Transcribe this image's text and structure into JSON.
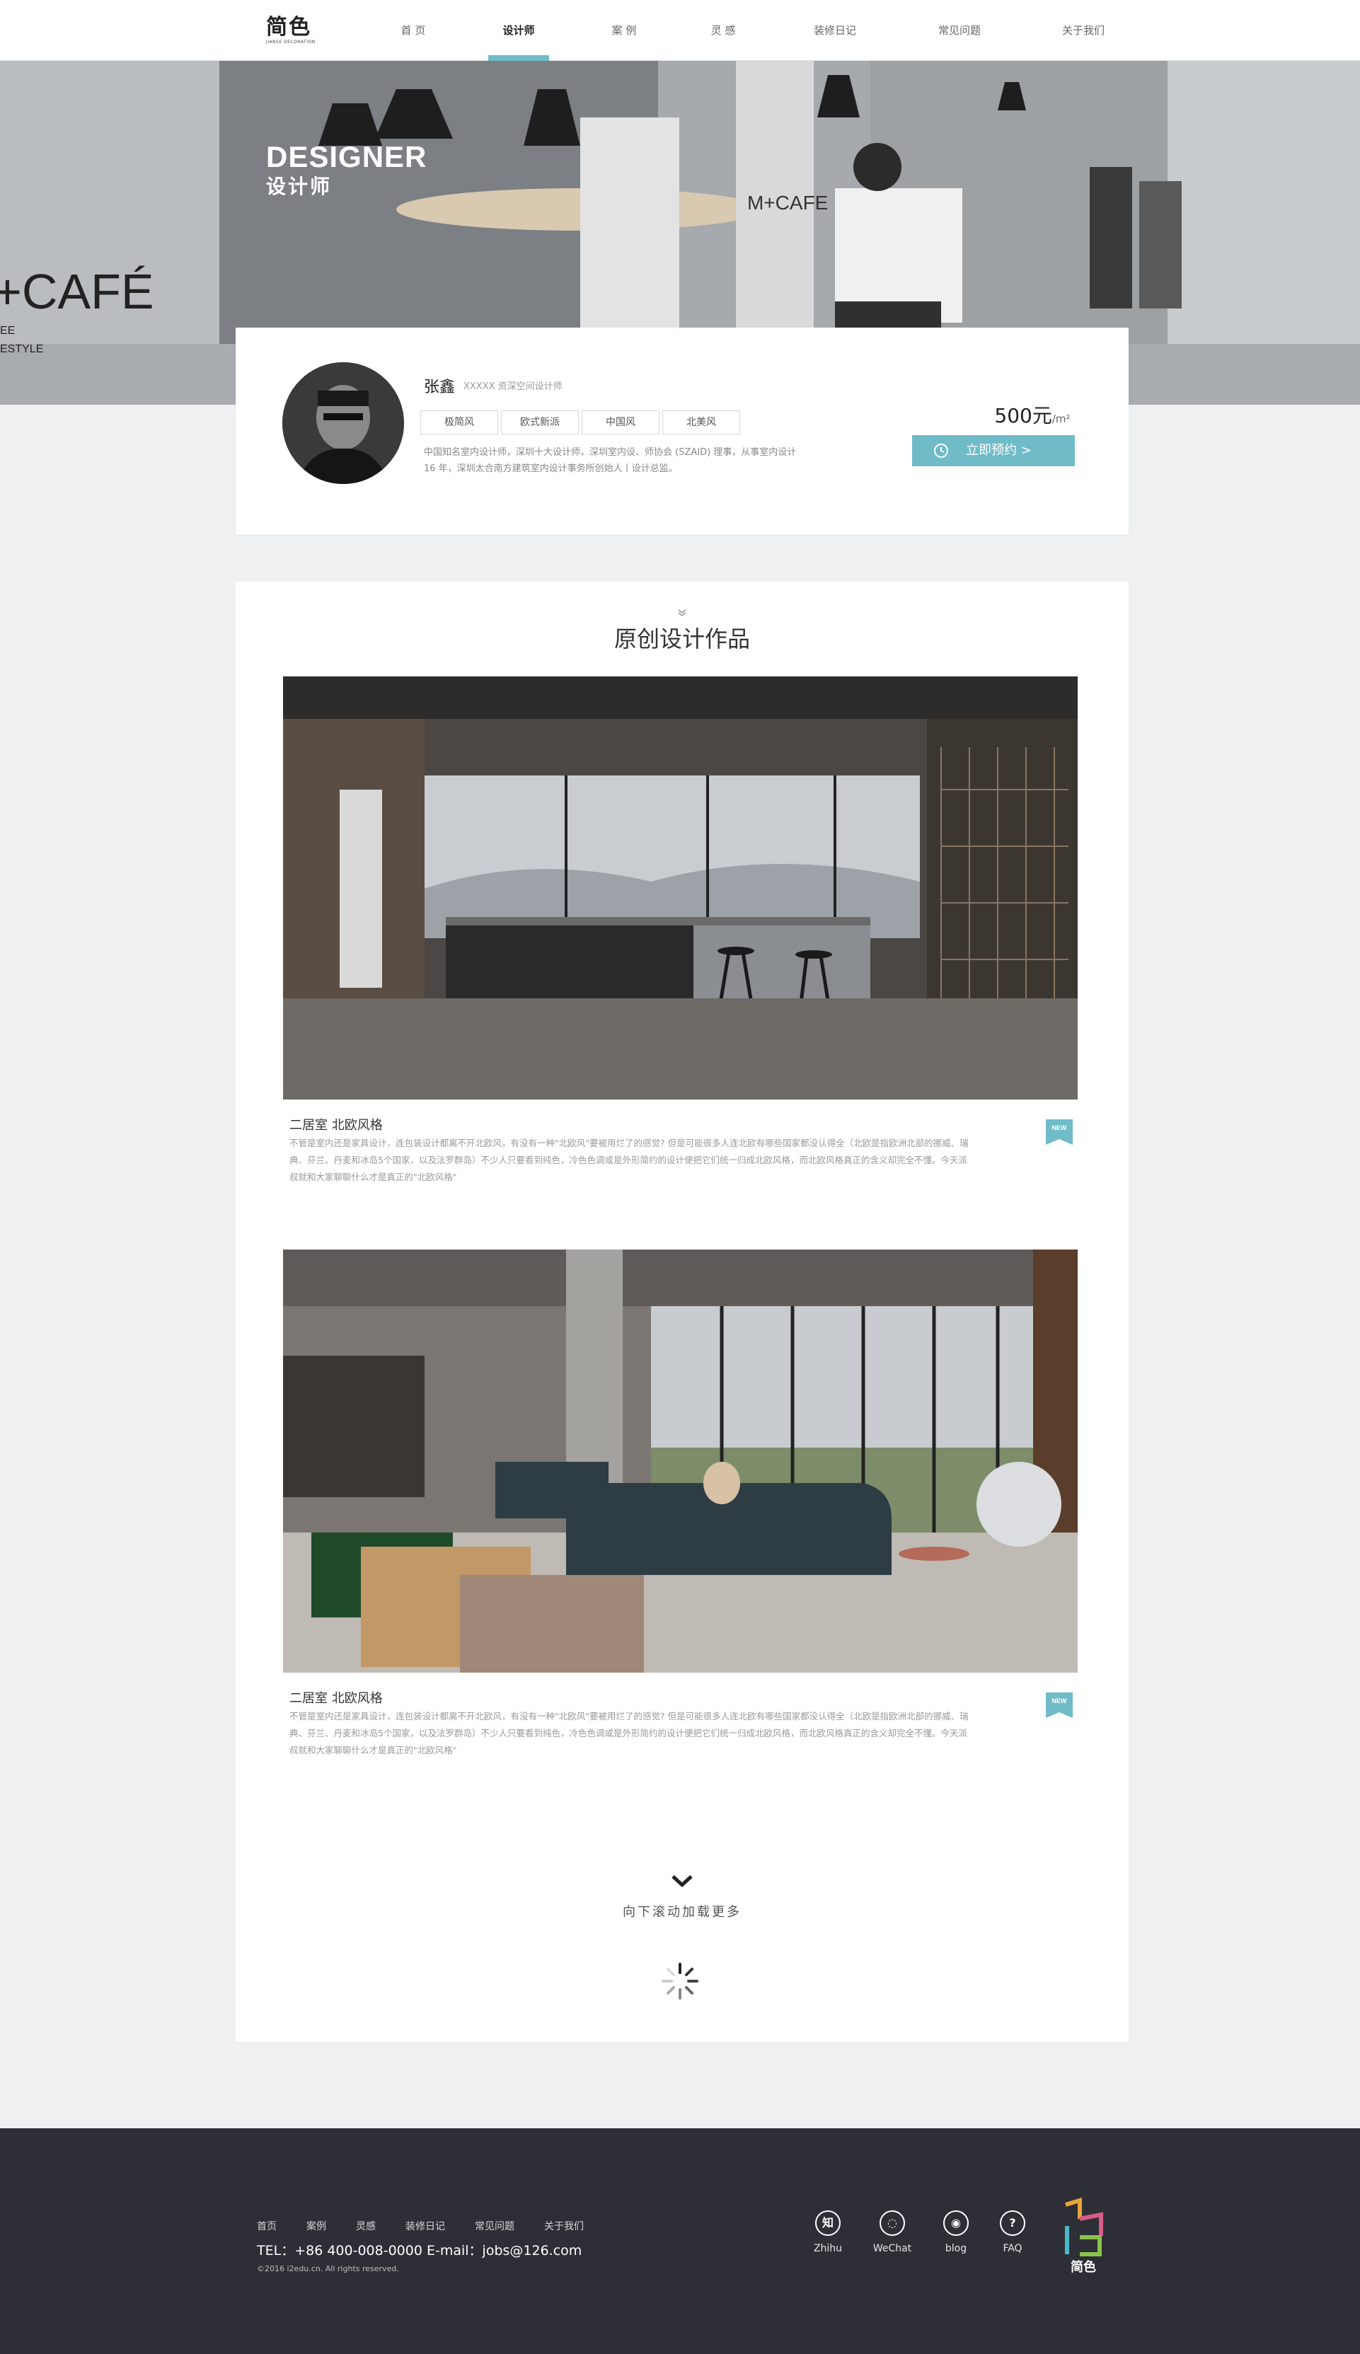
{
  "nav": {
    "logo": "简色",
    "logo_sub": "JIANSE DECORATION",
    "items": [
      "首 页",
      "设计师",
      "案 例",
      "灵 感",
      "装修日记",
      "常见问题",
      "关于我们"
    ],
    "active": "设计师"
  },
  "hero": {
    "title_en": "DESIGNER",
    "title_cn": "设计师",
    "sign_left": "+CAFÉ",
    "sign_left_sub1": "EE",
    "sign_left_sub2": "ESTYLE",
    "sign_right": "M+CAFE"
  },
  "designer": {
    "name": "张鑫",
    "title": "XXXXX 资深空间设计师",
    "tags": [
      "极简风",
      "欧式新派",
      "中国风",
      "北美风"
    ],
    "bio": "中国知名室内设计师，深圳十大设计师，深圳室内设、师协会 (SZAID) 理事，从事室内设计 16 年，深圳太合南方建筑室内设计事务所创始人丨设计总监。",
    "price": "500元",
    "price_unit": "/m²",
    "book_label": "立即预约  >"
  },
  "works": {
    "section_title": "原创设计作品",
    "items": [
      {
        "name": "二居室  北欧风格",
        "desc": "不管是室内还是家具设计，连包装设计都离不开北欧风，有没有一种\"北欧风\"要被用烂了的感觉? 但是可能很多人连北欧有哪些国家都没认得全（北欧是指欧洲北部的挪威、瑞典、芬兰、丹麦和冰岛5个国家，以及法罗群岛）不少人只要看到纯色，冷色色调或是外形简约的设计便把它们统一归成北欧风格，而北欧风格真正的含义却完全不懂。今天派叔就和大家聊聊什么才是真正的\"北欧风格\"",
        "badge": "NEW"
      },
      {
        "name": "二居室  北欧风格",
        "desc": "不管是室内还是家具设计，连包装设计都离不开北欧风，有没有一种\"北欧风\"要被用烂了的感觉? 但是可能很多人连北欧有哪些国家都没认得全（北欧是指欧洲北部的挪威、瑞典、芬兰、丹麦和冰岛5个国家，以及法罗群岛）不少人只要看到纯色，冷色色调或是外形简约的设计便把它们统一归成北欧风格，而北欧风格真正的含义却完全不懂。今天派叔就和大家聊聊什么才是真正的\"北欧风格\"",
        "badge": "NEW"
      }
    ],
    "load_more": "向下滚动加载更多"
  },
  "footer": {
    "links": [
      "首页",
      "案例",
      "灵感",
      "装修日记",
      "常见问题",
      "关于我们"
    ],
    "contact": "TEL：+86 400-008-0000    E-mail：jobs@126.com",
    "copyright": "©2016 i2edu.cn. All rights reserved.",
    "social": [
      {
        "label": "Zhihu",
        "glyph": "知",
        "icon": "zhihu-icon"
      },
      {
        "label": "WeChat",
        "glyph": "◌",
        "icon": "wechat-icon"
      },
      {
        "label": "blog",
        "glyph": "◉",
        "icon": "weibo-icon"
      },
      {
        "label": "FAQ",
        "glyph": "?",
        "icon": "faq-icon"
      }
    ],
    "logo": "简色"
  },
  "colors": {
    "accent": "#6fbcc8",
    "footer_bg": "#2e2f36",
    "page_bg": "#eef0f2"
  }
}
